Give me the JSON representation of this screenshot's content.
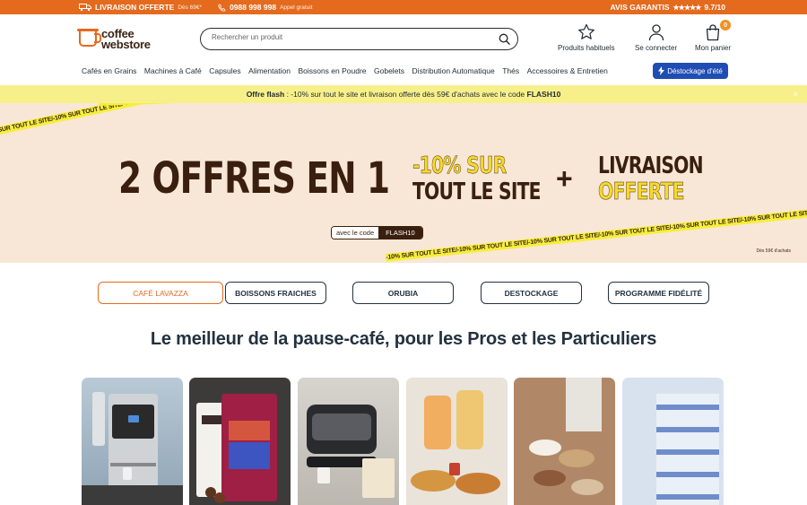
{
  "topbar": {
    "shipping_label": "LIVRAISON OFFERTE",
    "shipping_note": "Dès 69€*",
    "phone": "0988 998 998",
    "phone_note": "Appel gratuit",
    "reviews_label": "AVIS GARANTIS",
    "stars": "★★★★★",
    "rating": "9.7/10"
  },
  "header": {
    "logo_line1": "coffee",
    "logo_line2": "webstore",
    "search_placeholder": "Rechercher un produit",
    "favorites_label": "Produits habituels",
    "login_label": "Se connecter",
    "cart_label": "Mon panier",
    "cart_count": "0"
  },
  "nav": {
    "items": [
      {
        "label": "Cafés en Grains"
      },
      {
        "label": "Machines à Café"
      },
      {
        "label": "Capsules"
      },
      {
        "label": "Alimentation"
      },
      {
        "label": "Boissons en Poudre"
      },
      {
        "label": "Gobelets"
      },
      {
        "label": "Distribution Automatique"
      },
      {
        "label": "Thés"
      },
      {
        "label": "Accessoires & Entretien"
      }
    ],
    "cta_label": "Déstockage d'été"
  },
  "flash": {
    "bold": "Offre flash",
    "text": " : -10% sur tout le site et livraison offerte dès 59€ d'achats avec le code ",
    "code": "FLASH10",
    "close": "×"
  },
  "hero": {
    "tape_text": "-10% SUR TOUT LE SITE",
    "headline": "2 OFFRES EN 1",
    "promo_line1": "-10% SUR",
    "promo_line2": "TOUT LE SITE",
    "plus": "+",
    "ship_line1": "LIVRAISON",
    "ship_line2": "OFFERTE",
    "code_prefix": "avec le code",
    "code_value": "FLASH10",
    "note": "Dès 59€ d'achats",
    "colors": {
      "bg": "#f8e7d6",
      "tape": "#f6ee3c",
      "brown": "#3a1f0f",
      "yellow": "#f6d92a"
    }
  },
  "categories": [
    {
      "label": "CAFÉ LAVAZZA"
    },
    {
      "label": "BOISSONS FRAICHES"
    },
    {
      "label": "ORUBIA"
    },
    {
      "label": "DESTOCKAGE"
    },
    {
      "label": "PROGRAMME FIDÉLITÉ"
    }
  ],
  "tagline": "Le meilleur de la pause-café, pour les Pros et les Particuliers",
  "tiles": [
    {
      "name": "machine"
    },
    {
      "name": "coffee-bags"
    },
    {
      "name": "capsule-machine"
    },
    {
      "name": "breakfast"
    },
    {
      "name": "cups"
    },
    {
      "name": "water-bottles"
    }
  ],
  "colors": {
    "accent": "#e46a1e",
    "navy": "#233240",
    "blue_cta": "#1f4db3",
    "flash_bg": "#f7f08a"
  }
}
